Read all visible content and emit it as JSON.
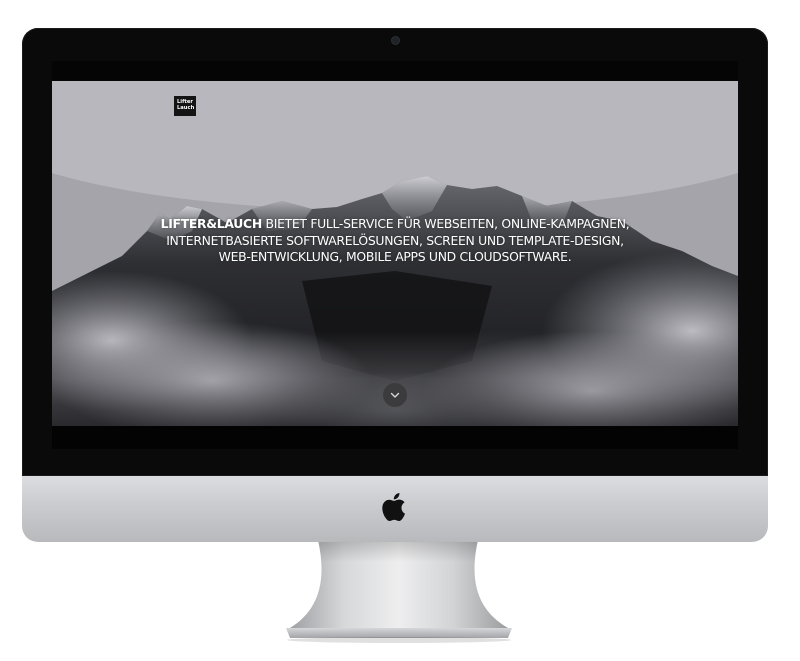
{
  "device": {
    "brand_icon": "apple-logo-icon"
  },
  "site": {
    "logo": {
      "line1": "Lifter",
      "line2": "Lauch"
    },
    "headline": {
      "brand": "LIFTER&LAUCH",
      "text": " BIETET FULL-SERVICE FÜR WEBSEITEN, ONLINE-KAMPAGNEN, INTERNETBASIERTE SOFTWARELÖSUNGEN, SCREEN UND TEMPLATE-DESIGN, WEB-ENTWICKLUNG, MOBILE APPS UND CLOUDSOFTWARE."
    },
    "scroll_button_icon": "chevron-down-icon"
  },
  "colors": {
    "bezel": "#0a0a0a",
    "chin": "#c9cbce",
    "logo_bg": "#141414",
    "scroll_button_bg": "#3b3b3d",
    "headline_text": "#ffffff"
  }
}
